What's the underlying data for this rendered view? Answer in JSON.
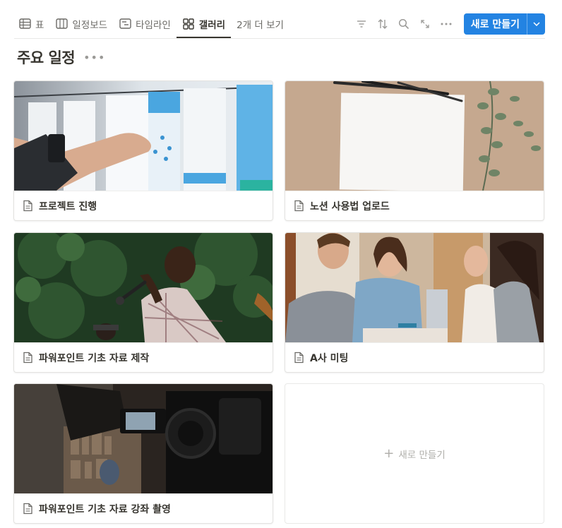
{
  "tabs": [
    {
      "label": "표",
      "icon": "table-icon"
    },
    {
      "label": "일정보드",
      "icon": "board-icon"
    },
    {
      "label": "타임라인",
      "icon": "timeline-icon"
    },
    {
      "label": "갤러리",
      "icon": "gallery-icon",
      "active": true
    },
    {
      "label": "2개 더 보기"
    }
  ],
  "toolbar": {
    "tools": [
      "filter-icon",
      "sort-icon",
      "search-icon",
      "expand-icon",
      "more-icon"
    ],
    "new_label": "새로 만들기"
  },
  "view": {
    "title": "주요 일정"
  },
  "cards": [
    {
      "title": "프로젝트 진행",
      "cover": "hand pinning documents on a whiteboard"
    },
    {
      "title": "노션 사용법 업로드",
      "cover": "blank paper with pens and eucalyptus"
    },
    {
      "title": "파워포인트 기초 자료 제작",
      "cover": "man singing into a microphone outdoors"
    },
    {
      "title": "A사 미팅",
      "cover": "group of people chatting with laptop"
    },
    {
      "title": "파워포인트 기초 자료 강좌 촬영",
      "cover": "video camera in a studio"
    }
  ],
  "add_card": {
    "label": "새로 만들기"
  },
  "colors": {
    "accent": "#2383e2",
    "text": "#37352f",
    "muted": "#9b9a97",
    "border": "#e3e2e0"
  }
}
